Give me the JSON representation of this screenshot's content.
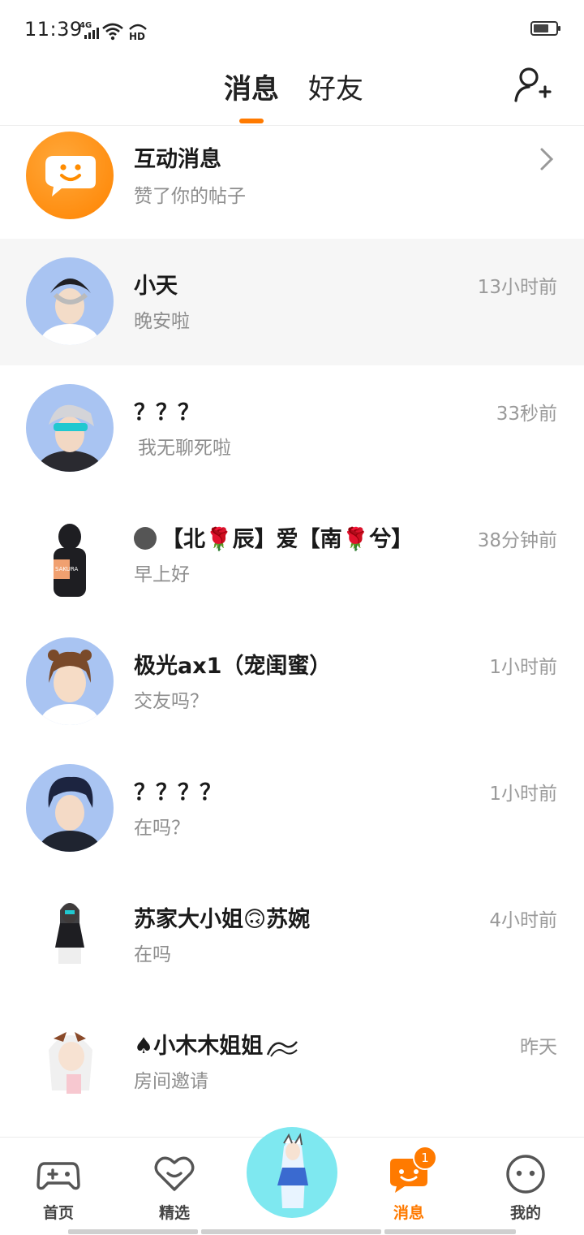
{
  "status_bar": {
    "time": "11:39",
    "network": "4G",
    "hd": "HD",
    "battery_level": 0.6
  },
  "header": {
    "tabs": [
      {
        "label": "消息",
        "active": true
      },
      {
        "label": "好友",
        "active": false
      }
    ],
    "add_friend_icon": "add-friend-icon"
  },
  "interaction": {
    "title": "互动消息",
    "subtitle": "赞了你的帖子",
    "icon": "chat-bubble-smile-icon",
    "color": "#ff8c00"
  },
  "conversations": [
    {
      "name": "小天",
      "preview": "晚安啦",
      "time": "13小时前",
      "highlighted": true
    },
    {
      "name": "？？？",
      "preview": "我无聊死啦",
      "time": "33秒前"
    },
    {
      "name": "【北🌹辰】爱【南🌹兮】",
      "preview": "早上好",
      "time": "38分钟前"
    },
    {
      "name": "极光ax1（宠闺蜜）",
      "preview": "交友吗？",
      "time": "1小时前"
    },
    {
      "name": "？？？？",
      "preview": "在吗？",
      "time": "1小时前"
    },
    {
      "name": "苏家大小姐🙃苏婉",
      "preview": "在吗",
      "time": "4小时前"
    },
    {
      "name": "♠小木木姐姐",
      "preview": "房间邀请",
      "time": "昨天"
    }
  ],
  "bottom_nav": {
    "items": [
      {
        "label": "首页",
        "icon": "gamepad-icon"
      },
      {
        "label": "精选",
        "icon": "heart-icon"
      },
      {
        "label": "消息",
        "icon": "message-icon",
        "badge": "1",
        "active": true
      },
      {
        "label": "我的",
        "icon": "face-icon"
      }
    ]
  },
  "colors": {
    "accent": "#ff7a00",
    "avatar_bg": "#a9c4f2",
    "center_bg": "#7ee8f0"
  }
}
